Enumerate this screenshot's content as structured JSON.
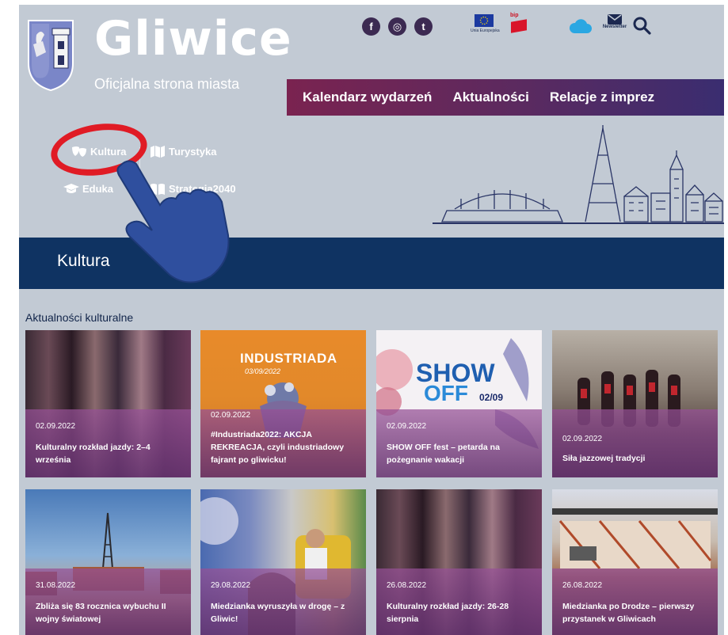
{
  "header": {
    "title": "Gliwice",
    "subtitle": "Oficjalna strona miasta",
    "eu_label": "Unia Europejska",
    "bip_label": "bip",
    "newsletter_label": "Newsletter",
    "socials": [
      {
        "icon": "facebook-icon",
        "glyph": "f"
      },
      {
        "icon": "instagram-icon",
        "glyph": "◎"
      },
      {
        "icon": "twitter-icon",
        "glyph": "t"
      }
    ]
  },
  "main_nav": [
    "Kalendarz wydarzeń",
    "Aktualności",
    "Relacje z imprez"
  ],
  "sub_nav": {
    "kultura": "Kultura",
    "turystyka": "Turystyka",
    "edukacja": "Eduka",
    "strategia": "Strategia2040"
  },
  "band": {
    "title": "Kultura"
  },
  "section": {
    "title": "Aktualności kulturalne"
  },
  "cards": [
    {
      "date": "02.09.2022",
      "title": "Kulturalny rozkład jazdy: 2–4 września"
    },
    {
      "date": "02.09.2022",
      "title": "#Industriada2022: AKCJA REKREACJA, czyli industriadowy fajrant po gliwicku!",
      "image_text": "INDUSTRIADA",
      "image_date": "03/09/2022"
    },
    {
      "date": "02.09.2022",
      "title": "SHOW OFF fest – petarda na pożegnanie wakacji",
      "image_text_1": "SHOW",
      "image_text_2": "OFF",
      "image_date": "02/09"
    },
    {
      "date": "02.09.2022",
      "title": "Siła jazzowej tradycji"
    },
    {
      "date": "31.08.2022",
      "title": "Zbliża się 83 rocznica wybuchu II wojny światowej"
    },
    {
      "date": "29.08.2022",
      "title": "Miedzianka wyruszyła w drogę – z Gliwic!"
    },
    {
      "date": "26.08.2022",
      "title": "Kulturalny rozkład jazdy: 26-28 sierpnia"
    },
    {
      "date": "26.08.2022",
      "title": "Miedzianka po Drodze – pierwszy przystanek w Gliwicach"
    }
  ],
  "colors": {
    "page_bg": "#c2cad4",
    "nav_start": "#7a2350",
    "nav_end": "#3a2d70",
    "band": "#0f3362",
    "highlight_circle": "#e01b25",
    "hand": "#2f4f9e"
  }
}
